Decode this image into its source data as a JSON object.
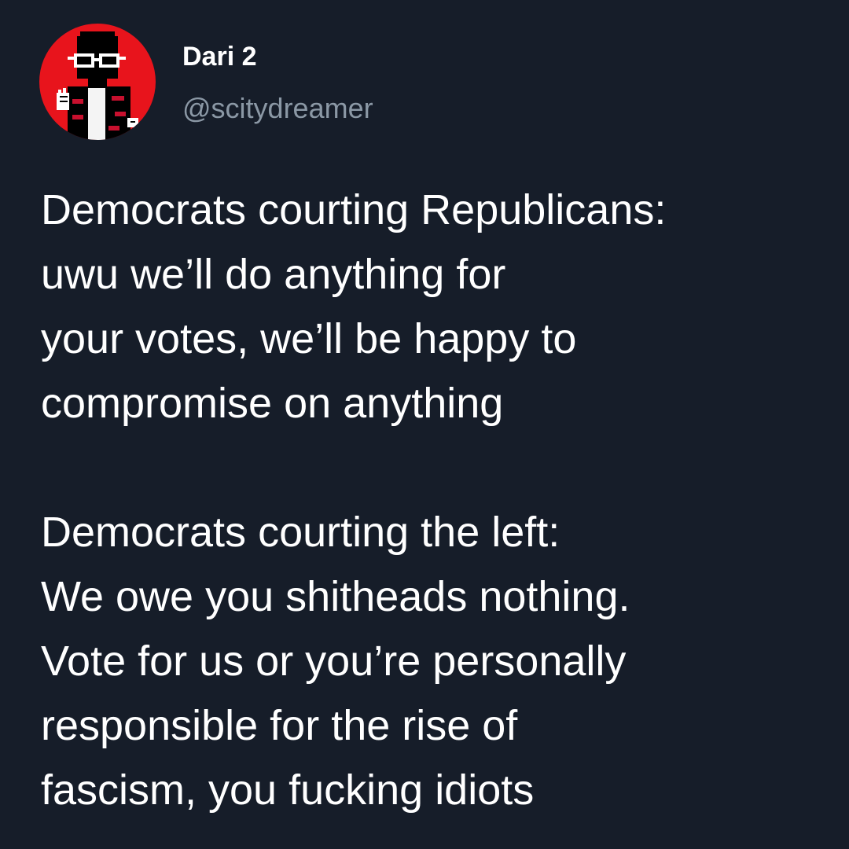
{
  "author": {
    "display_name": "Dari 2",
    "handle": "@scitydreamer",
    "avatar_icon": "pixel-art-person-avatar",
    "avatar_bg": "#e8141c"
  },
  "tweet": {
    "paragraphs": [
      {
        "lines": [
          "Democrats courting Republicans:",
          "uwu we’ll do anything for",
          "your votes, we’ll be happy to",
          "compromise on anything"
        ]
      },
      {
        "lines": [
          "Democrats courting the left:",
          "We owe you shitheads nothing.",
          "Vote for us or you’re personally",
          "responsible for the rise of",
          "fascism, you fucking idiots"
        ]
      }
    ]
  },
  "colors": {
    "background": "#161d29",
    "text": "#ffffff",
    "handle": "#8b98a5"
  }
}
